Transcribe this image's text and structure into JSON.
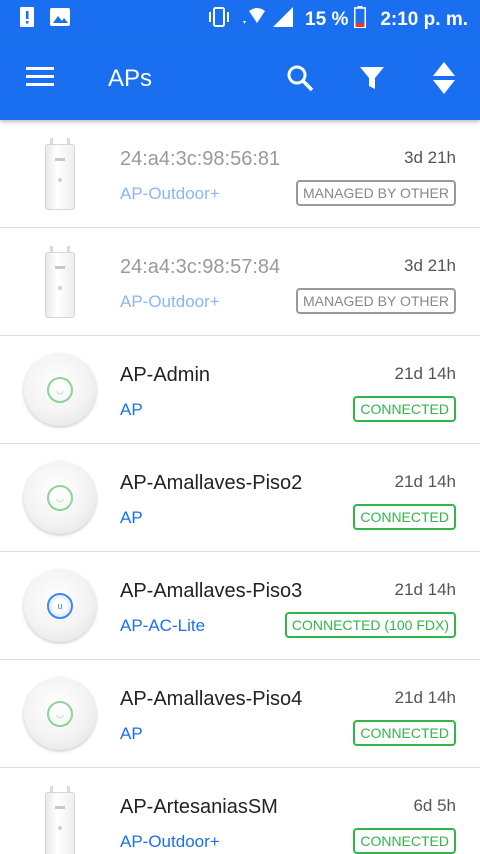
{
  "status_bar": {
    "battery_percent": "15 %",
    "time": "2:10 p. m.",
    "icons": [
      "alert-icon",
      "image-icon",
      "vibrate-icon",
      "wifi-icon",
      "signal-icon",
      "battery-low-icon"
    ]
  },
  "app_bar": {
    "title": "APs",
    "icons": [
      "menu-icon",
      "search-icon",
      "filter-icon",
      "sort-icon"
    ]
  },
  "colors": {
    "primary": "#1a6ff0",
    "connected": "#33b54a",
    "managed_by_other": "#888888"
  },
  "devices": [
    {
      "name": "24:a4:3c:98:56:81",
      "model": "AP-Outdoor+",
      "uptime": "3d 21h",
      "status": "MANAGED BY OTHER",
      "device_icon": "outdoor-ap-icon"
    },
    {
      "name": "24:a4:3c:98:57:84",
      "model": "AP-Outdoor+",
      "uptime": "3d 21h",
      "status": "MANAGED BY OTHER",
      "device_icon": "outdoor-ap-icon"
    },
    {
      "name": "AP-Admin",
      "model": "AP",
      "uptime": "21d 14h",
      "status": "CONNECTED",
      "device_icon": "indoor-ap-icon"
    },
    {
      "name": "AP-Amallaves-Piso2",
      "model": "AP",
      "uptime": "21d 14h",
      "status": "CONNECTED",
      "device_icon": "indoor-ap-icon"
    },
    {
      "name": "AP-Amallaves-Piso3",
      "model": "AP-AC-Lite",
      "uptime": "21d 14h",
      "status": "CONNECTED (100 FDX)",
      "device_icon": "ac-lite-ap-icon"
    },
    {
      "name": "AP-Amallaves-Piso4",
      "model": "AP",
      "uptime": "21d 14h",
      "status": "CONNECTED",
      "device_icon": "indoor-ap-icon"
    },
    {
      "name": "AP-ArtesaniasSM",
      "model": "AP-Outdoor+",
      "uptime": "6d 5h",
      "status": "CONNECTED",
      "device_icon": "outdoor-ap-icon"
    }
  ]
}
